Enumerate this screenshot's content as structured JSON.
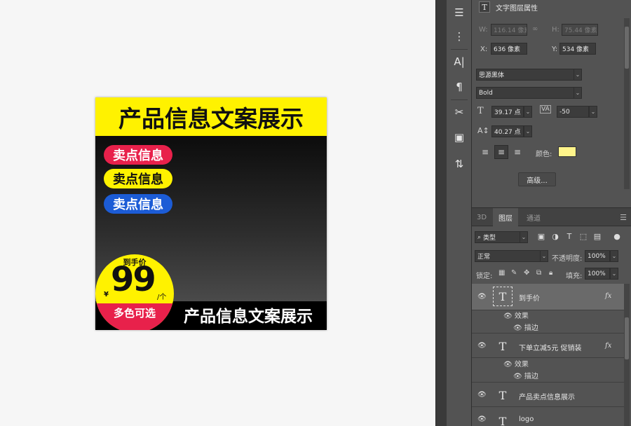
{
  "artboard": {
    "title": "产品信息文案展示",
    "pills": [
      "卖点信息",
      "卖点信息",
      "卖点信息"
    ],
    "price_label": "到手价",
    "price_currency": "¥",
    "price_value": "99",
    "price_unit": "/个",
    "colors_label": "多色可选",
    "bottom_text": "产品信息文案展示",
    "colors": {
      "yellow": "#fff200",
      "red": "#e8214b",
      "blue": "#1c5cd6",
      "black": "#000000"
    }
  },
  "tools": {
    "icons": [
      "sliders-icon",
      "stamp-list-icon",
      "character-icon",
      "paragraph-icon",
      "scissors-icon",
      "book-icon",
      "transform-icon"
    ],
    "glyphs": [
      "☰",
      "⋮",
      "A|",
      "¶",
      "✂",
      "▣",
      "⇅"
    ]
  },
  "properties": {
    "title": "文字图层属性",
    "w_label": "W:",
    "w_value": "116.14 像素",
    "h_label": "H:",
    "h_value": "75.44 像素",
    "link_icon": "∞",
    "x_label": "X:",
    "x_value": "636 像素",
    "y_label": "Y:",
    "y_value": "534 像素",
    "font_family": "思源黑体",
    "font_style": "Bold",
    "font_size": "39.17 点",
    "tracking": "-50",
    "leading": "40.27 点",
    "color_label": "颜色:",
    "swatch_color": "#fff48a",
    "advanced_button": "高级..."
  },
  "layers_panel": {
    "tabs": [
      "3D",
      "图层",
      "通道"
    ],
    "filter_kind": "类型",
    "blend_mode": "正常",
    "opacity_label": "不透明度:",
    "opacity_value": "100%",
    "lock_label": "锁定:",
    "fill_label": "填充:",
    "fill_value": "100%",
    "layers": [
      {
        "name": "到手价",
        "fx": "fx",
        "effects_label": "效果",
        "stroke_label": "描边"
      },
      {
        "name": "下单立减5元 促销装",
        "fx": "fx",
        "effects_label": "效果",
        "stroke_label": "描边"
      },
      {
        "name": "产品卖点信息展示"
      },
      {
        "name": "logo"
      }
    ]
  }
}
